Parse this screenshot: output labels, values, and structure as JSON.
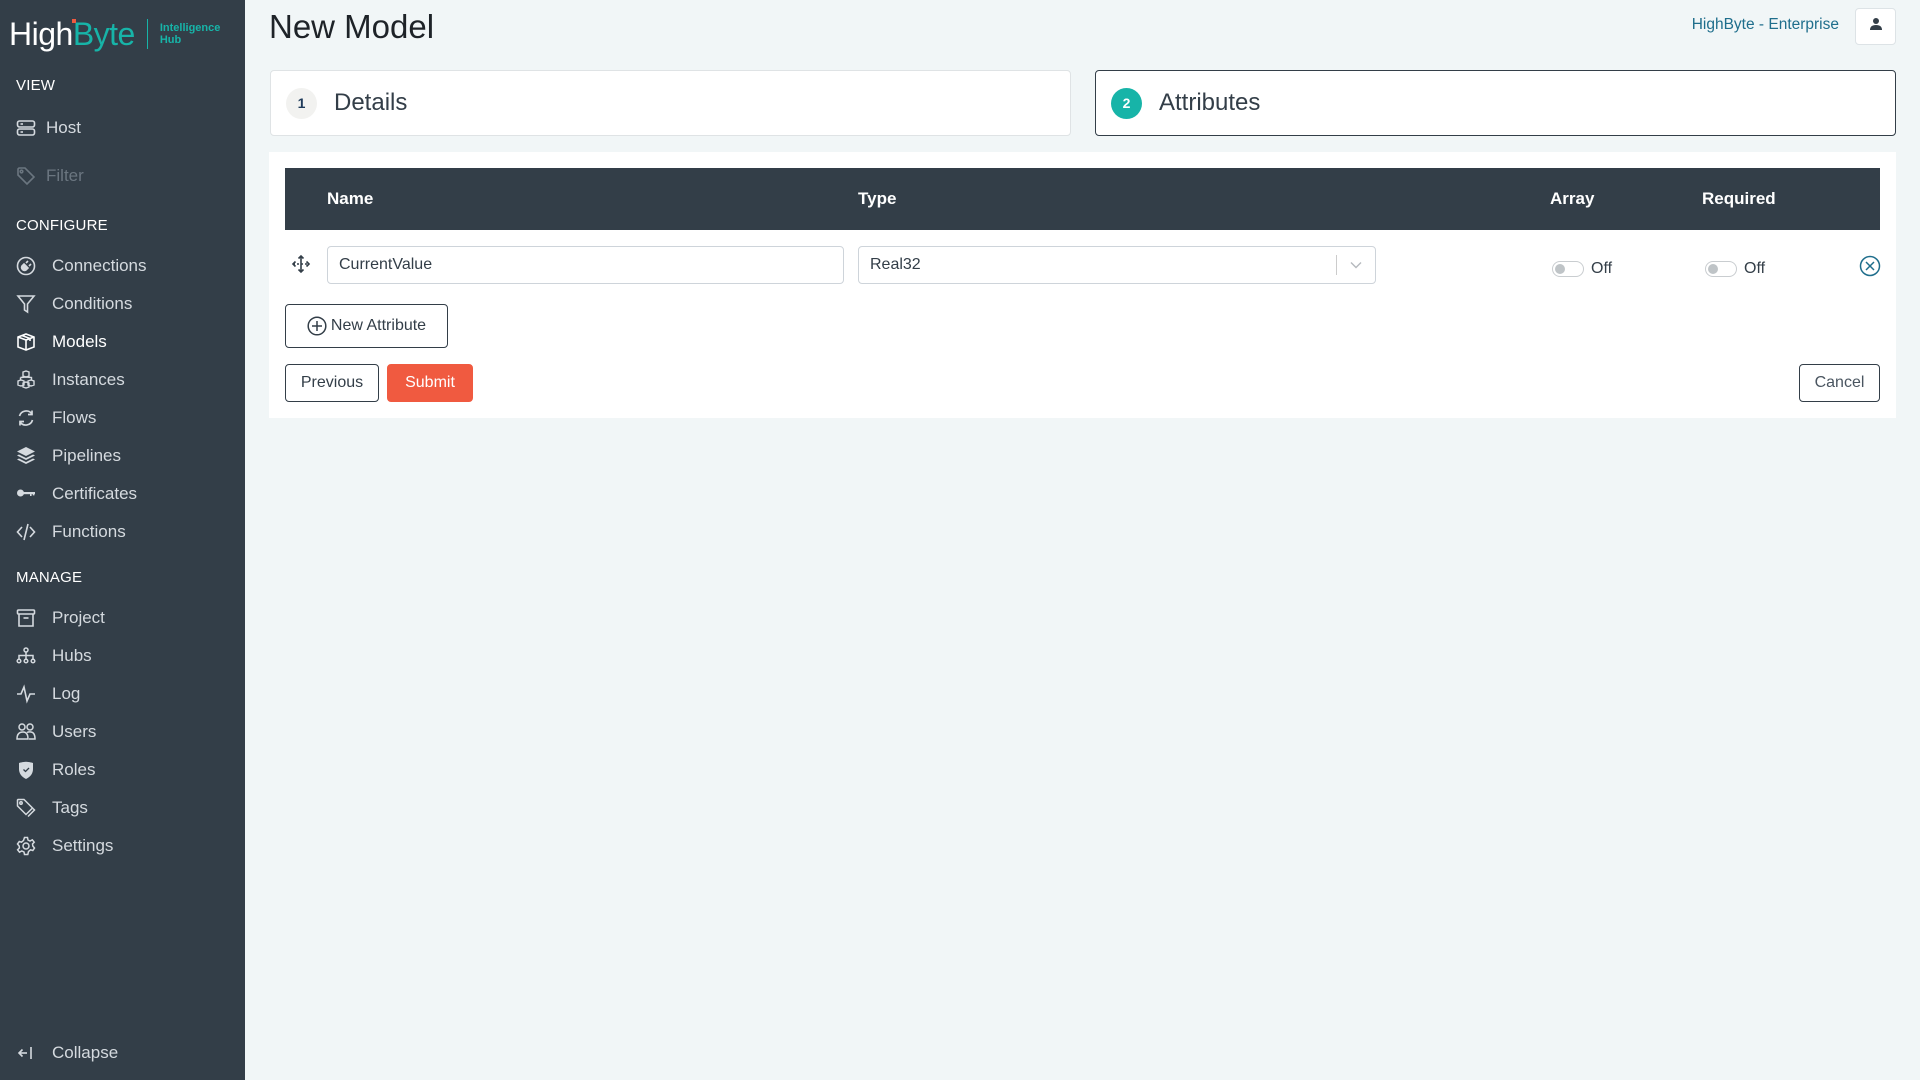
{
  "brand": {
    "logo_high": "High",
    "logo_byte": "Byte",
    "logo_sub_line1": "Intelligence",
    "logo_sub_line2": "Hub",
    "accent_color": "#17b4a8",
    "danger_color": "#f05a40"
  },
  "sidebar": {
    "sections": {
      "view": "VIEW",
      "configure": "CONFIGURE",
      "manage": "MANAGE"
    },
    "view_items": [
      {
        "label": "Host",
        "icon": "server-icon"
      },
      {
        "label": "Filter",
        "icon": "tag-icon",
        "disabled": true
      }
    ],
    "configure_items": [
      {
        "label": "Connections",
        "icon": "plug-icon"
      },
      {
        "label": "Conditions",
        "icon": "funnel-icon"
      },
      {
        "label": "Models",
        "icon": "cube-icon",
        "active": true
      },
      {
        "label": "Instances",
        "icon": "cubes-icon"
      },
      {
        "label": "Flows",
        "icon": "refresh-icon"
      },
      {
        "label": "Pipelines",
        "icon": "layers-icon"
      },
      {
        "label": "Certificates",
        "icon": "key-icon"
      },
      {
        "label": "Functions",
        "icon": "code-icon"
      }
    ],
    "manage_items": [
      {
        "label": "Project",
        "icon": "archive-icon"
      },
      {
        "label": "Hubs",
        "icon": "hierarchy-icon"
      },
      {
        "label": "Log",
        "icon": "activity-icon"
      },
      {
        "label": "Users",
        "icon": "users-icon"
      },
      {
        "label": "Roles",
        "icon": "shield-icon"
      },
      {
        "label": "Tags",
        "icon": "tags-icon"
      },
      {
        "label": "Settings",
        "icon": "gear-icon"
      }
    ],
    "collapse_label": "Collapse"
  },
  "header": {
    "title": "New Model",
    "org_label": "HighByte - Enterprise"
  },
  "steps": [
    {
      "number": "1",
      "label": "Details",
      "active": false
    },
    {
      "number": "2",
      "label": "Attributes",
      "active": true
    }
  ],
  "attributes_table": {
    "columns": [
      "Name",
      "Type",
      "Array",
      "Required"
    ],
    "rows": [
      {
        "name": "CurrentValue",
        "type": "Real32",
        "array": "Off",
        "required": "Off"
      }
    ]
  },
  "buttons": {
    "new_attribute": "New Attribute",
    "previous": "Previous",
    "submit": "Submit",
    "cancel": "Cancel"
  }
}
